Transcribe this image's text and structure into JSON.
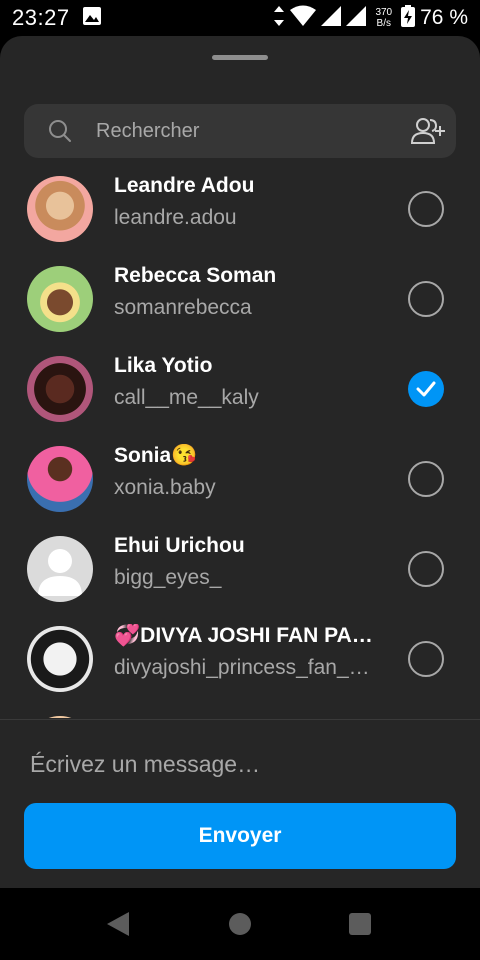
{
  "status_bar": {
    "time": "23:27",
    "net_speed_value": "370",
    "net_speed_unit": "B/s",
    "battery_percent": "76 %",
    "icons": [
      "gallery-icon",
      "data-arrows-icon",
      "wifi-icon",
      "signal-icon",
      "signal-icon",
      "battery-charging-icon"
    ]
  },
  "search": {
    "placeholder": "Rechercher",
    "icon": "search-icon",
    "add_icon": "add-people-icon"
  },
  "contacts": [
    {
      "name": "Leandre Adou",
      "username": "leandre.adou",
      "selected": false
    },
    {
      "name": "Rebecca Soman",
      "username": "somanrebecca",
      "selected": false
    },
    {
      "name": "Lika Yotio",
      "username": "call__me__kaly",
      "selected": true
    },
    {
      "name": "Sonia😘",
      "username": "xonia.baby",
      "selected": false
    },
    {
      "name": "Ehui Urichou",
      "username": "bigg_eyes_",
      "selected": false
    },
    {
      "name": "💞DIVYA JOSHI FAN PA…",
      "username": "divyajoshi_princess_fan_…",
      "selected": false
    }
  ],
  "composer": {
    "placeholder": "Écrivez un message…",
    "send_label": "Envoyer"
  },
  "colors": {
    "accent": "#0095f6",
    "sheet_bg": "#262626",
    "search_bg": "#363636",
    "secondary_text": "#a8a8a8"
  }
}
